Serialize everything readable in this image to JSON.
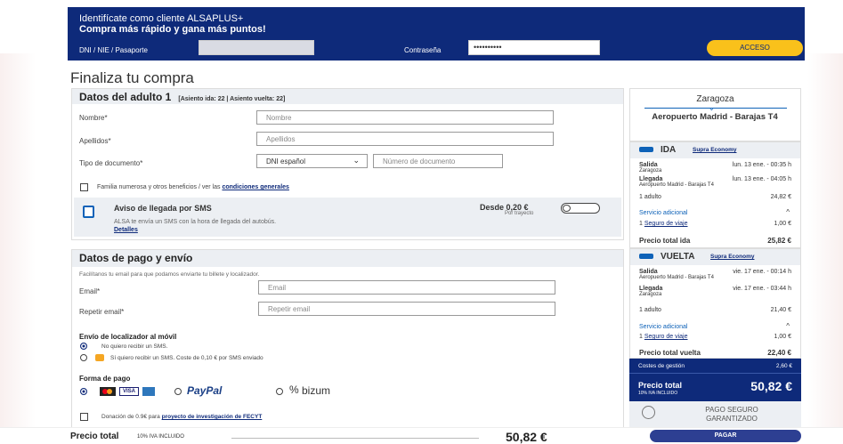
{
  "login": {
    "title": "Identifícate como cliente ALSAPLUS+",
    "subtitle": "Compra más rápido y gana más puntos!",
    "doc_label": "DNI / NIE / Pasaporte",
    "pass_label": "Contraseña",
    "pass_value": "••••••••••",
    "access": "ACCESO"
  },
  "page_title": "Finaliza tu compra",
  "adult": {
    "title": "Datos del adulto 1",
    "seats": "[Asiento ida: 22 | Asiento vuelta: 22]",
    "name_label": "Nombre*",
    "name_ph": "Nombre",
    "surname_label": "Apellidos*",
    "surname_ph": "Apellidos",
    "doctype_label": "Tipo de documento*",
    "doctype_value": "DNI español",
    "docnum_ph": "Número de documento",
    "family_text": "Familia numerosa y otros beneficios / ver las",
    "family_link": "condiciones generales",
    "sms_title": "Aviso de llegada por SMS",
    "sms_desc": "ALSA te envía un SMS con la hora de llegada del autobús.",
    "sms_details": "Detalles",
    "sms_price": "Desde 0,20 €",
    "sms_per": "Por trayecto"
  },
  "payment": {
    "title": "Datos de pago y envío",
    "intro": "Facilítanos tu email para que podamos enviarte tu billete y localizador.",
    "email_label": "Email*",
    "email_ph": "Email",
    "email2_label": "Repetir email*",
    "email2_ph": "Repetir email",
    "loc_title": "Envío de localizador al móvil",
    "opt1": "No quiero recibir un SMS.",
    "opt2": "Sí quiero recibir un SMS. Coste de 0,10 € por SMS enviado",
    "method_title": "Forma de pago",
    "visa": "VISA",
    "paypal": "PayPal",
    "bizum": "bizum",
    "donation_text": "Donación de 0.9€ para",
    "donation_link": "proyecto de investigación de FECYT"
  },
  "summary": {
    "origin": "Zaragoza",
    "dest": "Aeropuerto Madrid - Barajas T4",
    "ida": {
      "label": "IDA",
      "class": "Supra Economy",
      "salida": "Salida",
      "salida_from": "Zaragoza",
      "salida_time": "lun. 13 ene. - 00:35 h",
      "llegada": "Llegada",
      "llegada_to": "Aeropuerto Madrid - Barajas T4",
      "llegada_time": "lun. 13 ene. - 04:05 h",
      "adult": "1 adulto",
      "adult_price": "24,82 €",
      "extra": "Servicio adicional",
      "insurance_qty": "1",
      "insurance": "Seguro de viaje",
      "insurance_price": "1,00 €",
      "total_label": "Precio total ida",
      "total": "25,82 €"
    },
    "vuelta": {
      "label": "VUELTA",
      "class": "Supra Economy",
      "salida": "Salida",
      "salida_from": "Aeropuerto Madrid - Barajas T4",
      "salida_time": "vie. 17 ene. - 00:14 h",
      "llegada": "Llegada",
      "llegada_to": "Zaragoza",
      "llegada_time": "vie. 17 ene. - 03:44 h",
      "adult": "1 adulto",
      "adult_price": "21,40 €",
      "extra": "Servicio adicional",
      "insurance_qty": "1",
      "insurance": "Seguro de viaje",
      "insurance_price": "1,00 €",
      "total_label": "Precio total vuelta",
      "total": "22,40 €"
    },
    "fees_label": "Costes de gestión",
    "fees": "2,60 €",
    "grand_label": "Precio total",
    "grand_sub": "10% IVA INCLUIDO",
    "grand": "50,82 €",
    "secure1": "PAGO SEGURO",
    "secure2": "GARANTIZADO"
  },
  "footer": {
    "label": "Precio total",
    "sub": "10% IVA INCLUIDO",
    "amount": "50,82 €",
    "pay": "PAGAR"
  }
}
